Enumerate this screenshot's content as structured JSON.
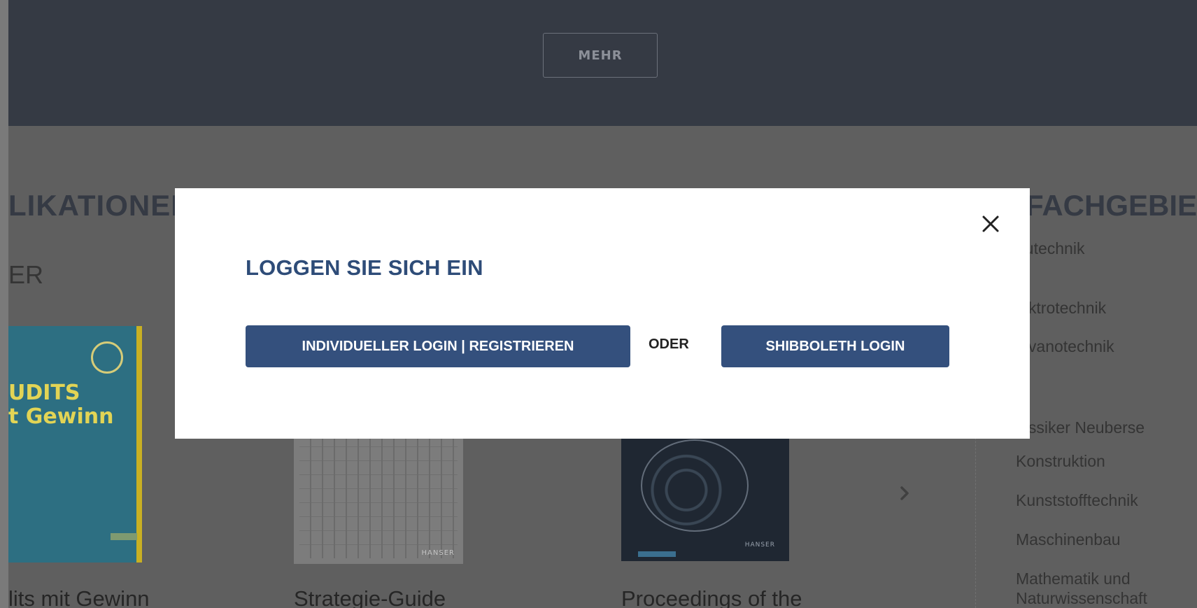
{
  "hero": {
    "more_button": "MEHR"
  },
  "publications": {
    "title": "LIKATIONEN",
    "subtitle": "ER"
  },
  "books": [
    {
      "title": "lits mit Gewinn",
      "cover_line1": "UDITS",
      "cover_line2": "t Gewinn"
    },
    {
      "title": "Strategie-Guide",
      "brand": "HANSER"
    },
    {
      "title": "Proceedings of the",
      "brand": "HANSER"
    }
  ],
  "categories": {
    "title": "FACHGEBIE",
    "items": [
      "autechnik",
      "lektrotechnik",
      "alvanotechnik",
      "lassiker Neuberse",
      "Konstruktion",
      "Kunststofftechnik",
      "Maschinenbau",
      "Mathematik und",
      "Naturwissenschaft"
    ]
  },
  "modal": {
    "title": "LOGGEN SIE SICH EIN",
    "individual_login_button": "INDIVIDUELLER LOGIN | REGISTRIEREN",
    "or_label": "ODER",
    "shibboleth_button": "SHIBBOLETH LOGIN"
  },
  "colors": {
    "overlay": "#5f5f5f",
    "hero": "#353a44",
    "primary": "#34507d",
    "title": "#2e4c78"
  }
}
